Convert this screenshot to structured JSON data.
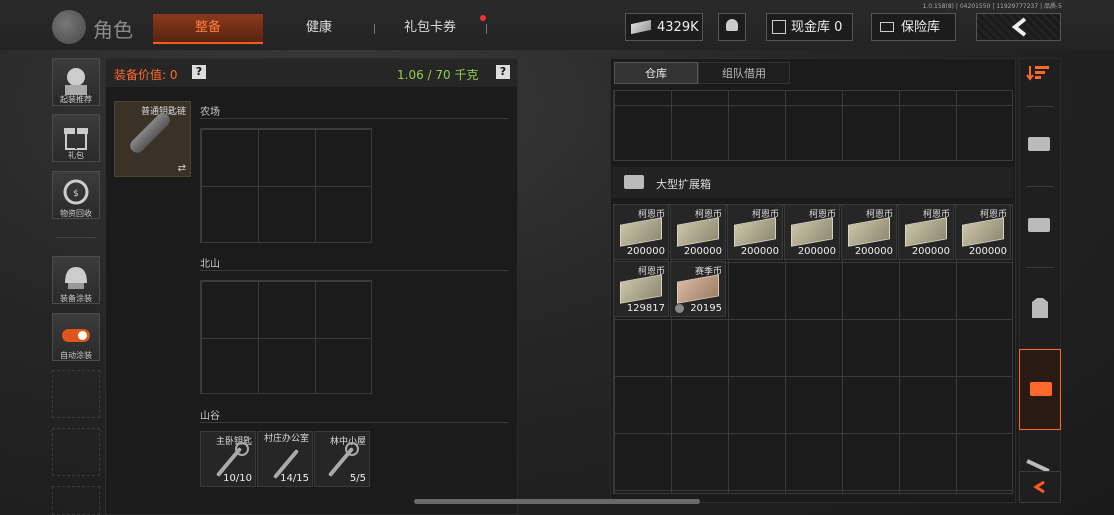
{
  "version": "1.0.158(8) | 04201550 | 11929777237 | 品质-5",
  "header": {
    "title": "角色",
    "tabs": [
      {
        "label": "整备",
        "active": true
      },
      {
        "label": "健康",
        "active": false
      },
      {
        "label": "礼包卡券",
        "active": false,
        "notification": true
      }
    ],
    "cash_amount": "4329K",
    "cash_vault_label": "现金库 0",
    "safe_label": "保险库"
  },
  "left_sidebar": {
    "items": [
      {
        "label": "起装推荐",
        "icon": "soldier-icon"
      },
      {
        "label": "礼包",
        "icon": "gift-icon"
      },
      {
        "label": "物资回收",
        "icon": "recycle-icon"
      },
      {
        "label": "装备涂装",
        "icon": "helmet-icon"
      },
      {
        "label": "自动涂装",
        "icon": "toggle-icon",
        "toggle_on": true
      }
    ]
  },
  "equipment": {
    "value_label": "装备价值: 0",
    "weight_label": "1.06 / 70 千克",
    "help": "?",
    "keychain_name": "普通钥匙链",
    "sections": [
      {
        "title": "农场"
      },
      {
        "title": "北山"
      },
      {
        "title": "山谷"
      }
    ],
    "valley_keys": [
      {
        "name": "主卧钥匙",
        "count": "10/10"
      },
      {
        "name": "村庄办公室",
        "count": "14/15"
      },
      {
        "name": "林中小屋",
        "count": "5/5"
      }
    ]
  },
  "warehouse": {
    "tabs": [
      {
        "label": "仓库",
        "active": true
      },
      {
        "label": "组队借用",
        "active": false
      }
    ],
    "container_title": "大型扩展箱",
    "items": [
      {
        "name": "柯恩币",
        "count": "200000"
      },
      {
        "name": "柯恩币",
        "count": "200000"
      },
      {
        "name": "柯恩币",
        "count": "200000"
      },
      {
        "name": "柯恩币",
        "count": "200000"
      },
      {
        "name": "柯恩币",
        "count": "200000"
      },
      {
        "name": "柯恩币",
        "count": "200000"
      },
      {
        "name": "柯恩币",
        "count": "200000"
      },
      {
        "name": "柯恩币",
        "count": "129817"
      },
      {
        "name": "赛季币",
        "count": "20195"
      }
    ]
  },
  "colors": {
    "accent": "#ff5a1a",
    "weight_green": "#8fd14f",
    "value_orange": "#ff6a2a"
  }
}
